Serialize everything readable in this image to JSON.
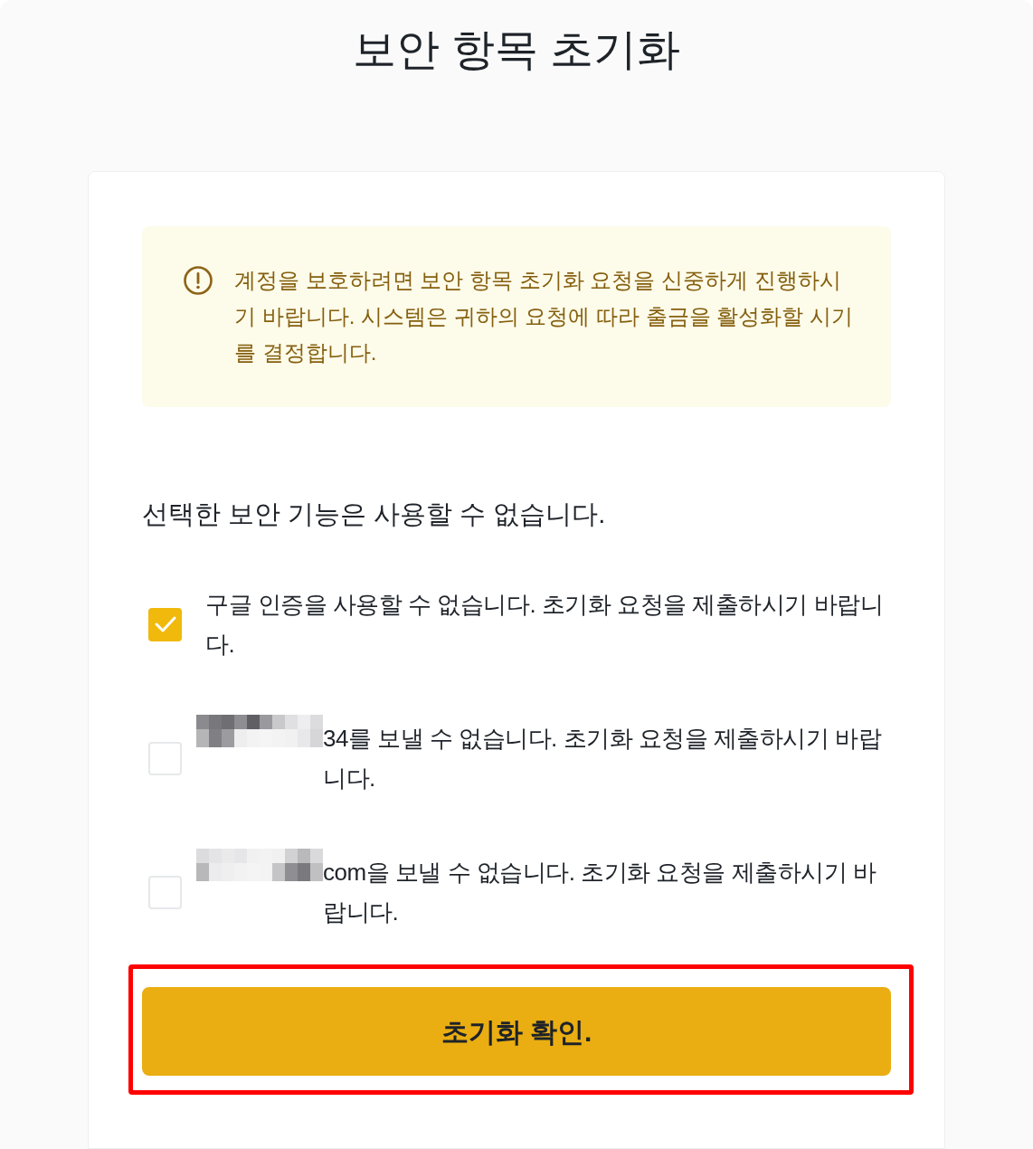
{
  "title": "보안 항목 초기화",
  "notice": {
    "text": "계정을 보호하려면 보안 항목 초기화 요청을 신중하게 진행하시기 바랍니다. 시스템은 귀하의 요청에 따라 출금을 활성화할 시기를 결정합니다."
  },
  "section_heading": "선택한 보안 기능은 사용할 수 없습니다.",
  "options": [
    {
      "text": "구글 인증을 사용할 수 없습니다. 초기화 요청을 제출하시기 바랍니다.",
      "checked": true,
      "redacted": false
    },
    {
      "text": "34를 보낼 수 없습니다. 초기화 요청을 제출하시기 바랍니다.",
      "checked": false,
      "redacted": true
    },
    {
      "text": "com을 보낼 수 없습니다. 초기화 요청을 제출하시기 바랍니다.",
      "checked": false,
      "redacted": true
    }
  ],
  "confirm_button": {
    "label": "초기화 확인.",
    "highlighted": true
  }
}
